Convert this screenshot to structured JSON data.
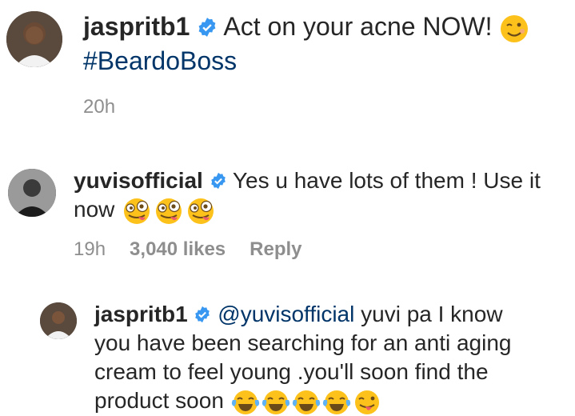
{
  "post": {
    "username": "jaspritb1",
    "text": " Act on your acne NOW! ",
    "hashtag": "#BeardoBoss",
    "time": "20h"
  },
  "comment": {
    "username": "yuvisofficial",
    "text_line1": " Yes u have lots of them ! Use it",
    "text_line2": "now ",
    "time": "19h",
    "likes": "3,040 likes",
    "reply_label": "Reply"
  },
  "reply": {
    "username": "jaspritb1",
    "mention": "@yuvisofficial",
    "text_line1": " yuvi pa I know",
    "text_line2": "you have been searching for an anti aging",
    "text_line3": "cream to feel young .you'll soon find the",
    "text_line4": "product soon "
  },
  "icons": {
    "verified": "verified-badge-icon",
    "wink": "winking-face-emoji",
    "zany": "zany-face-emoji",
    "laughing": "face-with-tears-of-joy-emoji"
  },
  "colors": {
    "verified": "#3897f0",
    "hashtag": "#003569",
    "meta": "#8e8e8e",
    "text": "#262626"
  }
}
